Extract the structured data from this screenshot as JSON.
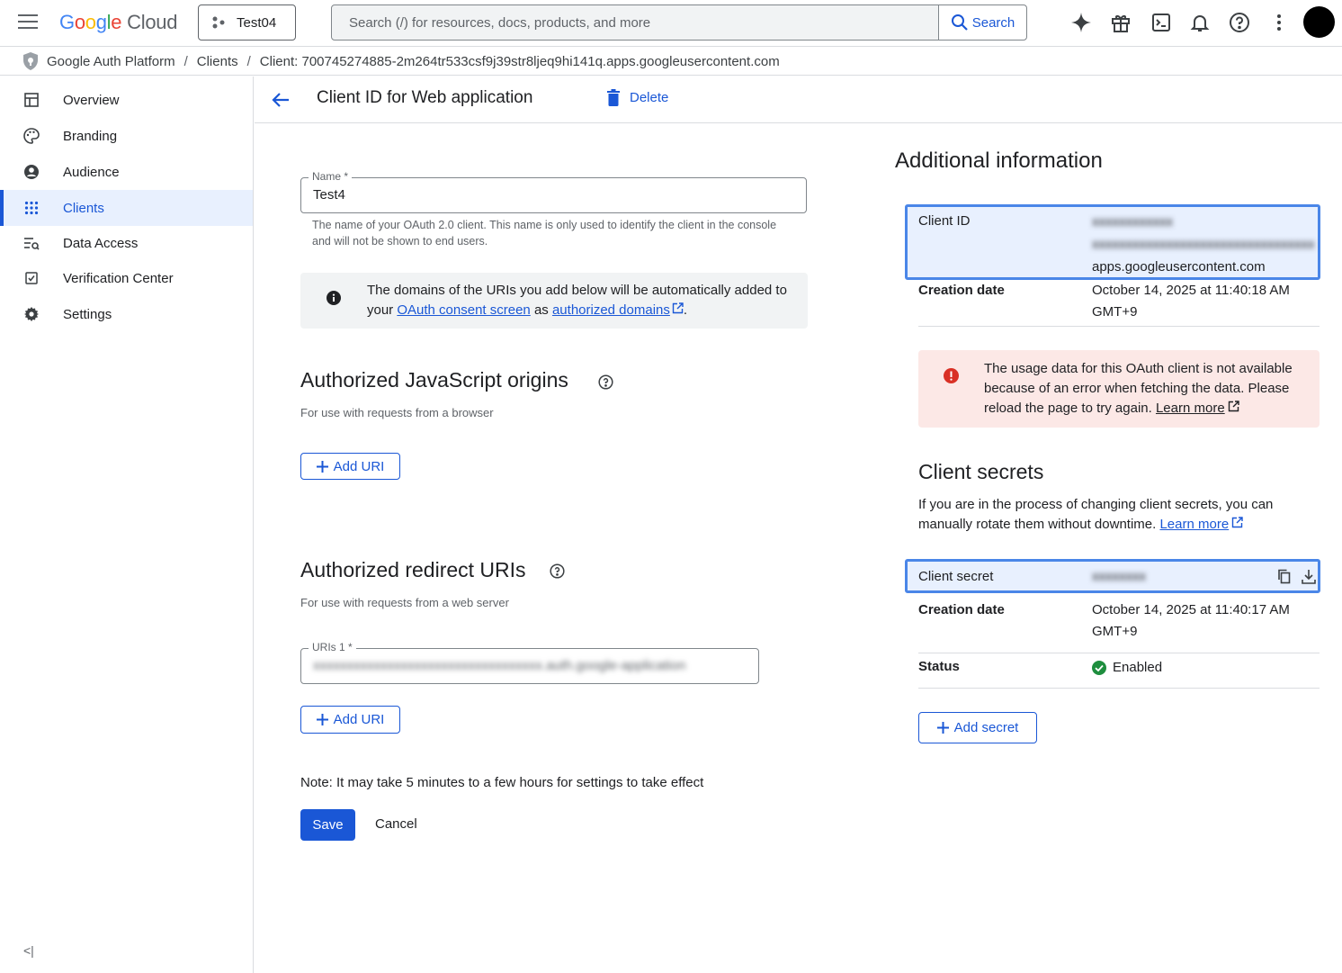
{
  "topbar": {
    "brand_google": [
      "G",
      "o",
      "o",
      "g",
      "l",
      "e"
    ],
    "brand_cloud": "Cloud",
    "project": "Test04",
    "search_placeholder": "Search (/) for resources, docs, products, and more",
    "search_button": "Search",
    "icons": [
      "gemini-sparkle-icon",
      "gift-icon",
      "cloud-shell-icon",
      "notifications-icon",
      "help-icon",
      "more-vert-icon"
    ]
  },
  "breadcrumb": {
    "root": "Google Auth Platform",
    "clients": "Clients",
    "current": "Client: 700745274885-2m264tr533csf9j39str8ljeq9hi141q.apps.googleusercontent.com",
    "separator": "/"
  },
  "sidebar": {
    "items": [
      {
        "label": "Overview",
        "icon": "dashboard-icon"
      },
      {
        "label": "Branding",
        "icon": "palette-icon"
      },
      {
        "label": "Audience",
        "icon": "person-icon"
      },
      {
        "label": "Clients",
        "icon": "apps-grid-icon",
        "active": true
      },
      {
        "label": "Data Access",
        "icon": "data-access-icon"
      },
      {
        "label": "Verification Center",
        "icon": "verified-icon"
      },
      {
        "label": "Settings",
        "icon": "settings-icon"
      }
    ],
    "collapse": "<|"
  },
  "header": {
    "title": "Client ID for Web application",
    "delete": "Delete"
  },
  "form": {
    "name_label": "Name *",
    "name_value": "Test4",
    "name_helper": "The name of your OAuth 2.0 client. This name is only used to identify the client in the console and will not be shown to end users.",
    "info_text_1": "The domains of the URIs you add below will be automatically added to your ",
    "info_link_1": "OAuth consent screen",
    "info_text_2": " as ",
    "info_link_2": "authorized domains",
    "info_text_3": ".",
    "js_origins_title": "Authorized JavaScript origins",
    "js_origins_sub": "For use with requests from a browser",
    "add_uri": "Add URI",
    "redirect_title": "Authorized redirect URIs",
    "redirect_sub": "For use with requests from a web server",
    "uri_label": "URIs 1 *",
    "uri_value": "xxxxxxxxxxxxxxxxxxxxxxxxxxxxxxxxxx.auth.google-application",
    "note": "Note: It may take 5 minutes to a few hours for settings to take effect",
    "save": "Save",
    "cancel": "Cancel"
  },
  "additional": {
    "title": "Additional information",
    "client_id_label": "Client ID",
    "client_id_line1": "xxxxxxxxxxxx",
    "client_id_line2": "xxxxxxxxxxxxxxxxxxxxxxxxxxxxxxxxx",
    "client_id_line3": "apps.googleusercontent.com",
    "creation_label": "Creation date",
    "creation_value_1": "October 14, 2025 at 11:40:18 AM",
    "creation_value_2": "GMT+9",
    "error_text": "The usage data for this OAuth client is not available because of an error when fetching the data. Please reload the page to try again. ",
    "error_link": "Learn more"
  },
  "secrets": {
    "title": "Client secrets",
    "desc": "If you are in the process of changing client secrets, you can manually rotate them without downtime. ",
    "desc_link": "Learn more",
    "secret_label": "Client secret",
    "secret_value": "xxxxxxxx",
    "creation_label": "Creation date",
    "creation_value_1": "October 14, 2025 at 11:40:17 AM",
    "creation_value_2": "GMT+9",
    "status_label": "Status",
    "status_value": "Enabled",
    "add_secret": "Add secret"
  },
  "colors": {
    "accent": "#1a57d6",
    "highlight_border": "#4a86e8",
    "error_bg": "#fce8e6",
    "success": "#1e8e3e"
  }
}
